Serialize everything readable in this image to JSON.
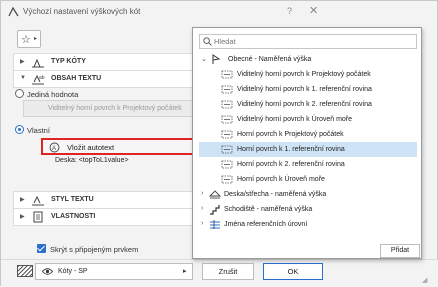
{
  "window": {
    "title": "Výchozí nastavení výškových kót",
    "help_label": "?",
    "close_label": "✕"
  },
  "sections": {
    "type": "TYP KÓTY",
    "text_content": "OBSAH TEXTU",
    "text_style": "STYL TEXTU",
    "properties": "VLASTNOSTI"
  },
  "text_content": {
    "single_value_label": "Jediná hodnota",
    "single_value_field": "Viditelný horní povrch k Projektový počátek",
    "custom_label": "Vlastní",
    "insert_autotext_label": "Vložit autotext",
    "field_text": "Deska: <topToL1value>"
  },
  "options": {
    "hide_with_element_label": "Skrýt s připojeným prvkem"
  },
  "footer": {
    "layer_name": "Kóty - SP",
    "cancel_label": "Zrušit",
    "ok_label": "OK"
  },
  "popup": {
    "search_placeholder": "Hledat",
    "add_label": "Přidat",
    "items": [
      {
        "label": "Obecné - Naměřená výška",
        "level": 0,
        "expanded": true,
        "icon": "general-elevation-icon"
      },
      {
        "label": "Viditelný horní povrch k Projektový počátek",
        "level": 1,
        "icon": "autotext-field-icon"
      },
      {
        "label": "Viditelný horní povrch k 1. referenční rovina",
        "level": 1,
        "icon": "autotext-field-icon"
      },
      {
        "label": "Viditelný horní povrch k 2. referenční rovina",
        "level": 1,
        "icon": "autotext-field-icon"
      },
      {
        "label": "Viditelný horní povrch k Úroveň moře",
        "level": 1,
        "icon": "autotext-field-icon"
      },
      {
        "label": "Horní povrch k Projektový počátek",
        "level": 1,
        "icon": "autotext-field-icon"
      },
      {
        "label": "Horní povrch k 1. referenční rovina",
        "level": 1,
        "icon": "autotext-field-icon",
        "selected": true
      },
      {
        "label": "Horní povrch k 2. referenční rovina",
        "level": 1,
        "icon": "autotext-field-icon"
      },
      {
        "label": "Horní povrch k Úroveň moře",
        "level": 1,
        "icon": "autotext-field-icon"
      },
      {
        "label": "Deska/střecha - naměřená výška",
        "level": 0,
        "icon": "slab-roof-icon"
      },
      {
        "label": "Schodiště - naměřená výška",
        "level": 0,
        "icon": "stair-icon"
      },
      {
        "label": "Jména referenčních úrovní",
        "level": 0,
        "icon": "reference-level-icon"
      }
    ]
  },
  "colors": {
    "accent": "#2b6fcf",
    "highlight": "#e02424",
    "selection": "#cfe3f7"
  }
}
